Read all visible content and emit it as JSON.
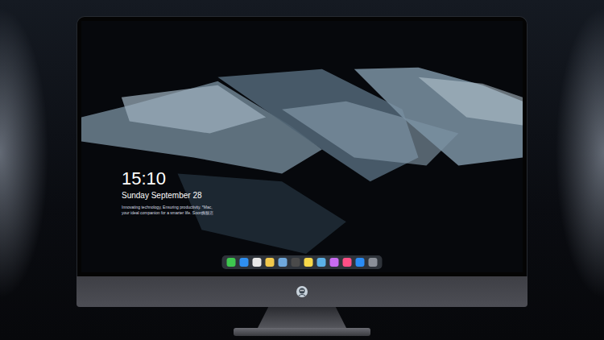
{
  "screen": {
    "time": "15:10",
    "date": "Sunday September 28",
    "tagline": [
      "Innovating technology, Ensuring productivity. *Mac,",
      "your ideal companion for a smarter life. Soon旗舰店"
    ]
  },
  "dock": {
    "items": [
      {
        "color": "#3ec74f"
      },
      {
        "color": "#2f8ff0"
      },
      {
        "color": "#e8e8e8"
      },
      {
        "color": "#f2c94c"
      },
      {
        "color": "#6fa8dc"
      },
      {
        "color": "#4a4a4a"
      },
      {
        "color": "#f7d84a"
      },
      {
        "color": "#5bb0e6"
      },
      {
        "color": "#c86bf0"
      },
      {
        "color": "#ff4f86"
      },
      {
        "color": "#2a8cf5"
      },
      {
        "color": "#8a8f98"
      }
    ]
  }
}
